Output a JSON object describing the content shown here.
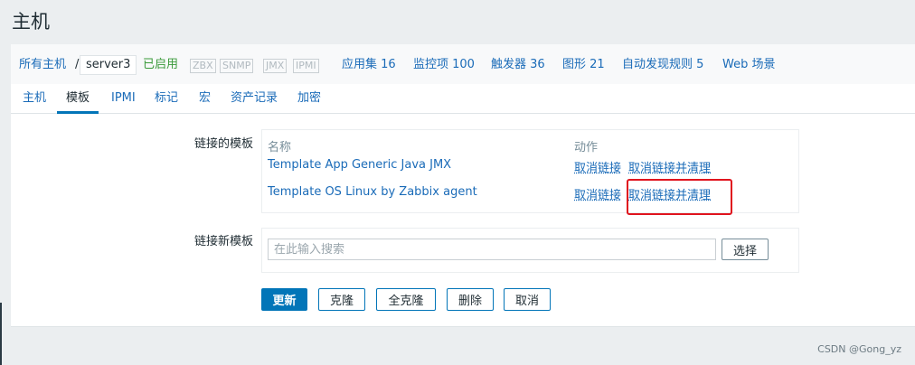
{
  "page": {
    "title": "主机"
  },
  "breadcrumb": {
    "all_hosts": "所有主机",
    "separator": "/",
    "host": "server3",
    "status": "已启用"
  },
  "availability": [
    "ZBX",
    "SNMP",
    "JMX",
    "IPMI"
  ],
  "host_links": {
    "applications": "应用集 16",
    "items": "监控项 100",
    "triggers": "触发器 36",
    "graphs": "图形 21",
    "discovery": "自动发现规则 5",
    "web": "Web 场景"
  },
  "tabs": [
    {
      "label": "主机",
      "active": false
    },
    {
      "label": "模板",
      "active": true
    },
    {
      "label": "IPMI",
      "active": false
    },
    {
      "label": "标记",
      "active": false
    },
    {
      "label": "宏",
      "active": false
    },
    {
      "label": "资产记录",
      "active": false
    },
    {
      "label": "加密",
      "active": false
    }
  ],
  "linked_templates": {
    "label": "链接的模板",
    "col_name": "名称",
    "col_action": "动作",
    "rows": [
      {
        "name": "Template App Generic Java JMX",
        "unlink": "取消链接",
        "unlink_clear": "取消链接并清理"
      },
      {
        "name": "Template OS Linux by Zabbix agent",
        "unlink": "取消链接",
        "unlink_clear": "取消链接并清理"
      }
    ]
  },
  "link_new": {
    "label": "链接新模板",
    "placeholder": "在此输入搜索",
    "select_button": "选择"
  },
  "buttons": {
    "update": "更新",
    "clone": "克隆",
    "full_clone": "全克隆",
    "delete": "删除",
    "cancel": "取消"
  },
  "watermark": "CSDN @Gong_yz",
  "colors": {
    "accent": "#0275b8",
    "link": "#1a6bb8",
    "highlight": "#e0141e",
    "enabled": "#3a9a3a"
  }
}
